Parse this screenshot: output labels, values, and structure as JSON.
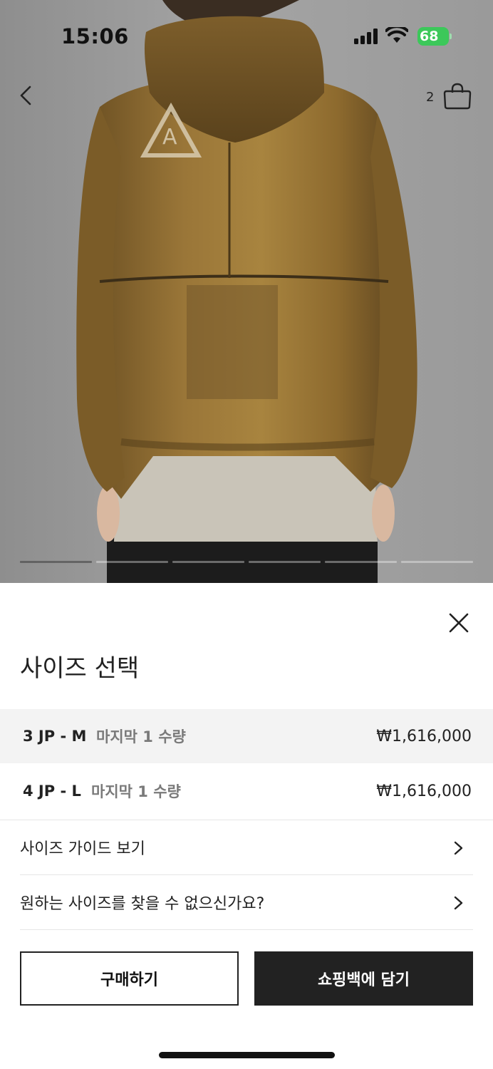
{
  "status_bar": {
    "time": "15:06",
    "battery": "68",
    "battery_color": "#3cc85a"
  },
  "nav": {
    "back_icon": "chevron-left-icon",
    "cart_count": "2",
    "bag_icon": "shopping-bag-icon"
  },
  "gallery": {
    "image_count": 6,
    "active_index": 0
  },
  "sheet": {
    "close_icon": "close-icon",
    "title": "사이즈 선택",
    "sizes": [
      {
        "size": "3 JP - M",
        "stock": "마지막 1 수량",
        "price": "₩1,616,000",
        "selected": true
      },
      {
        "size": "4 JP - L",
        "stock": "마지막 1 수량",
        "price": "₩1,616,000",
        "selected": false
      }
    ],
    "links": [
      {
        "label": "사이즈 가이드 보기",
        "icon": "chevron-right-icon"
      },
      {
        "label": "원하는 사이즈를 찾을 수 없으신가요?",
        "icon": "chevron-right-icon"
      }
    ],
    "buy_label": "구매하기",
    "add_label": "쇼핑백에 담기"
  },
  "colors": {
    "primary_button": "#222222",
    "selected_row": "#f3f3f3",
    "stock_text": "#7a7a7a"
  }
}
